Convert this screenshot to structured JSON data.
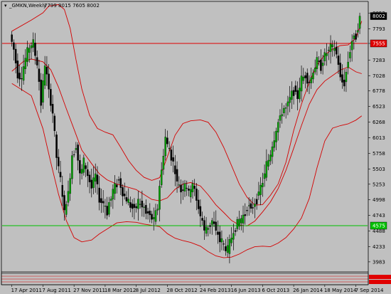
{
  "title": {
    "symbol": "_GMKN,Weekly",
    "ohlc": "7799 8015 7605 8002"
  },
  "colors": {
    "background": "#c0c0c0",
    "frame": "#000000",
    "bull_candle": "#00a000",
    "bear_candle": "#000000",
    "wick": "#000000",
    "bands": "#d40000",
    "red_level_line": "#e00000",
    "green_level_line": "#00c000",
    "last_price_box": "#000000",
    "red_level_box": "#e00000",
    "green_level_box": "#00c000"
  },
  "chart_data": {
    "type": "candlestick",
    "title": "_GMKN,Weekly",
    "ohlc_readout": [
      7799,
      8015,
      7605,
      8002
    ],
    "y_ticks": [
      8052,
      7793,
      7555,
      7283,
      7028,
      6778,
      6523,
      6268,
      6013,
      5758,
      5503,
      5253,
      4998,
      4743,
      4488,
      4233,
      3983
    ],
    "y_range": [
      3830,
      8230
    ],
    "x_labels": [
      "17 Apr 2011",
      "7 Aug 2011",
      "27 Nov 2011",
      "18 Mar 2012",
      "8 Jul 2012",
      "28 Oct 2012",
      "24 Feb 2013",
      "16 Jun 2013",
      "6 Oct 2013",
      "26 Jan 2014",
      "18 May 2014",
      "7 Sep 2014"
    ],
    "price_labels": {
      "last_price": "8002",
      "red_level": "7555",
      "green_level": "4575"
    },
    "horizontal_levels": [
      {
        "value": 7555,
        "color": "red"
      },
      {
        "value": 4575,
        "color": "green"
      }
    ],
    "bands": {
      "upper": [
        {
          "x": "17 Apr 2011",
          "y": 7755
        },
        {
          "x": "26 Jun 2011",
          "y": 7935
        },
        {
          "x": "7 Aug 2011",
          "y": 8055
        },
        {
          "x": "28 Aug 2011",
          "y": 8165
        },
        {
          "x": "2 Oct 2011",
          "y": 8190
        },
        {
          "x": "23 Oct 2011",
          "y": 8110
        },
        {
          "x": "13 Nov 2011",
          "y": 7800
        },
        {
          "x": "4 Dec 2011",
          "y": 7290
        },
        {
          "x": "25 Dec 2011",
          "y": 6810
        },
        {
          "x": "22 Jan 2012",
          "y": 6380
        },
        {
          "x": "19 Feb 2012",
          "y": 6165
        },
        {
          "x": "18 Mar 2012",
          "y": 6105
        },
        {
          "x": "15 Apr 2012",
          "y": 6060
        },
        {
          "x": "13 May 2012",
          "y": 5855
        },
        {
          "x": "10 Jun 2012",
          "y": 5640
        },
        {
          "x": "8 Jul 2012",
          "y": 5480
        },
        {
          "x": "5 Aug 2012",
          "y": 5365
        },
        {
          "x": "2 Sep 2012",
          "y": 5315
        },
        {
          "x": "30 Sep 2012",
          "y": 5360
        },
        {
          "x": "28 Oct 2012",
          "y": 5700
        },
        {
          "x": "25 Nov 2012",
          "y": 6055
        },
        {
          "x": "23 Dec 2012",
          "y": 6245
        },
        {
          "x": "20 Jan 2013",
          "y": 6290
        },
        {
          "x": "24 Feb 2013",
          "y": 6305
        },
        {
          "x": "24 Mar 2013",
          "y": 6265
        },
        {
          "x": "21 Apr 2013",
          "y": 6105
        },
        {
          "x": "19 May 2013",
          "y": 5855
        },
        {
          "x": "16 Jun 2013",
          "y": 5560
        },
        {
          "x": "14 Jul 2013",
          "y": 5255
        },
        {
          "x": "11 Aug 2013",
          "y": 5040
        },
        {
          "x": "8 Sep 2013",
          "y": 4910
        },
        {
          "x": "6 Oct 2013",
          "y": 4920
        },
        {
          "x": "3 Nov 2013",
          "y": 5070
        },
        {
          "x": "1 Dec 2013",
          "y": 5255
        },
        {
          "x": "29 Dec 2013",
          "y": 5610
        },
        {
          "x": "26 Jan 2014",
          "y": 6130
        },
        {
          "x": "23 Feb 2014",
          "y": 6560
        },
        {
          "x": "23 Mar 2014",
          "y": 6920
        },
        {
          "x": "20 Apr 2014",
          "y": 7200
        },
        {
          "x": "18 May 2014",
          "y": 7370
        },
        {
          "x": "15 Jun 2014",
          "y": 7460
        },
        {
          "x": "13 Jul 2014",
          "y": 7520
        },
        {
          "x": "10 Aug 2014",
          "y": 7530
        },
        {
          "x": "7 Sep 2014",
          "y": 7640
        },
        {
          "x": "28 Sep 2014",
          "y": 7920
        }
      ],
      "middle": [
        {
          "x": "17 Apr 2011",
          "y": 7100
        },
        {
          "x": "29 May 2011",
          "y": 7260
        },
        {
          "x": "26 Jun 2011",
          "y": 7300
        },
        {
          "x": "7 Aug 2011",
          "y": 7255
        },
        {
          "x": "4 Sep 2011",
          "y": 7125
        },
        {
          "x": "2 Oct 2011",
          "y": 6840
        },
        {
          "x": "30 Oct 2011",
          "y": 6490
        },
        {
          "x": "27 Nov 2011",
          "y": 6150
        },
        {
          "x": "25 Dec 2011",
          "y": 5810
        },
        {
          "x": "29 Jan 2012",
          "y": 5590
        },
        {
          "x": "26 Feb 2012",
          "y": 5425
        },
        {
          "x": "25 Mar 2012",
          "y": 5325
        },
        {
          "x": "29 Apr 2012",
          "y": 5255
        },
        {
          "x": "3 Jun 2012",
          "y": 5210
        },
        {
          "x": "8 Jul 2012",
          "y": 5165
        },
        {
          "x": "5 Aug 2012",
          "y": 5085
        },
        {
          "x": "2 Sep 2012",
          "y": 5005
        },
        {
          "x": "30 Sep 2012",
          "y": 4980
        },
        {
          "x": "28 Oct 2012",
          "y": 5030
        },
        {
          "x": "25 Nov 2012",
          "y": 5170
        },
        {
          "x": "23 Dec 2012",
          "y": 5255
        },
        {
          "x": "20 Jan 2013",
          "y": 5280
        },
        {
          "x": "24 Feb 2013",
          "y": 5225
        },
        {
          "x": "24 Mar 2013",
          "y": 5080
        },
        {
          "x": "21 Apr 2013",
          "y": 4915
        },
        {
          "x": "19 May 2013",
          "y": 4790
        },
        {
          "x": "16 Jun 2013",
          "y": 4660
        },
        {
          "x": "14 Jul 2013",
          "y": 4585
        },
        {
          "x": "11 Aug 2013",
          "y": 4570
        },
        {
          "x": "8 Sep 2013",
          "y": 4650
        },
        {
          "x": "6 Oct 2013",
          "y": 4800
        },
        {
          "x": "3 Nov 2013",
          "y": 4960
        },
        {
          "x": "1 Dec 2013",
          "y": 5180
        },
        {
          "x": "29 Dec 2013",
          "y": 5480
        },
        {
          "x": "26 Jan 2014",
          "y": 5840
        },
        {
          "x": "23 Feb 2014",
          "y": 6210
        },
        {
          "x": "23 Mar 2014",
          "y": 6560
        },
        {
          "x": "20 Apr 2014",
          "y": 6800
        },
        {
          "x": "18 May 2014",
          "y": 6940
        },
        {
          "x": "15 Jun 2014",
          "y": 7030
        },
        {
          "x": "13 Jul 2014",
          "y": 7120
        },
        {
          "x": "10 Aug 2014",
          "y": 7170
        },
        {
          "x": "7 Sep 2014",
          "y": 7090
        },
        {
          "x": "28 Sep 2014",
          "y": 7060
        }
      ],
      "lower": [
        {
          "x": "17 Apr 2011",
          "y": 6900
        },
        {
          "x": "26 Jun 2011",
          "y": 6700
        },
        {
          "x": "7 Aug 2011",
          "y": 6160
        },
        {
          "x": "4 Sep 2011",
          "y": 5610
        },
        {
          "x": "2 Oct 2011",
          "y": 5090
        },
        {
          "x": "30 Oct 2011",
          "y": 4660
        },
        {
          "x": "27 Nov 2011",
          "y": 4380
        },
        {
          "x": "25 Dec 2011",
          "y": 4310
        },
        {
          "x": "29 Jan 2012",
          "y": 4340
        },
        {
          "x": "26 Feb 2012",
          "y": 4440
        },
        {
          "x": "25 Mar 2012",
          "y": 4520
        },
        {
          "x": "29 Apr 2012",
          "y": 4620
        },
        {
          "x": "3 Jun 2012",
          "y": 4640
        },
        {
          "x": "8 Jul 2012",
          "y": 4630
        },
        {
          "x": "5 Aug 2012",
          "y": 4600
        },
        {
          "x": "2 Sep 2012",
          "y": 4580
        },
        {
          "x": "30 Sep 2012",
          "y": 4560
        },
        {
          "x": "28 Oct 2012",
          "y": 4445
        },
        {
          "x": "25 Nov 2012",
          "y": 4370
        },
        {
          "x": "23 Dec 2012",
          "y": 4330
        },
        {
          "x": "20 Jan 2013",
          "y": 4300
        },
        {
          "x": "24 Feb 2013",
          "y": 4240
        },
        {
          "x": "24 Mar 2013",
          "y": 4150
        },
        {
          "x": "21 Apr 2013",
          "y": 4080
        },
        {
          "x": "19 May 2013",
          "y": 4050
        },
        {
          "x": "16 Jun 2013",
          "y": 4060
        },
        {
          "x": "14 Jul 2013",
          "y": 4110
        },
        {
          "x": "11 Aug 2013",
          "y": 4180
        },
        {
          "x": "8 Sep 2013",
          "y": 4230
        },
        {
          "x": "6 Oct 2013",
          "y": 4240
        },
        {
          "x": "3 Nov 2013",
          "y": 4230
        },
        {
          "x": "1 Dec 2013",
          "y": 4290
        },
        {
          "x": "29 Dec 2013",
          "y": 4380
        },
        {
          "x": "26 Jan 2014",
          "y": 4520
        },
        {
          "x": "23 Feb 2014",
          "y": 4700
        },
        {
          "x": "23 Mar 2014",
          "y": 5020
        },
        {
          "x": "20 Apr 2014",
          "y": 5520
        },
        {
          "x": "18 May 2014",
          "y": 5960
        },
        {
          "x": "15 Jun 2014",
          "y": 6170
        },
        {
          "x": "13 Jul 2014",
          "y": 6210
        },
        {
          "x": "10 Aug 2014",
          "y": 6240
        },
        {
          "x": "7 Sep 2014",
          "y": 6300
        },
        {
          "x": "28 Sep 2014",
          "y": 6370
        }
      ]
    },
    "price_path": [
      {
        "x": "17 Apr 2011",
        "y": 7700
      },
      {
        "x": "1 May 2011",
        "y": 7450
      },
      {
        "x": "15 May 2011",
        "y": 7050
      },
      {
        "x": "29 May 2011",
        "y": 7000
      },
      {
        "x": "12 Jun 2011",
        "y": 7300
      },
      {
        "x": "26 Jun 2011",
        "y": 7500
      },
      {
        "x": "10 Jul 2011",
        "y": 7550
      },
      {
        "x": "24 Jul 2011",
        "y": 7200
      },
      {
        "x": "7 Aug 2011",
        "y": 6600
      },
      {
        "x": "21 Aug 2011",
        "y": 7200
      },
      {
        "x": "4 Sep 2011",
        "y": 6800
      },
      {
        "x": "18 Sep 2011",
        "y": 6400
      },
      {
        "x": "2 Oct 2011",
        "y": 5700
      },
      {
        "x": "16 Oct 2011",
        "y": 5300
      },
      {
        "x": "30 Oct 2011",
        "y": 4800
      },
      {
        "x": "13 Nov 2011",
        "y": 5100
      },
      {
        "x": "27 Nov 2011",
        "y": 5700
      },
      {
        "x": "11 Dec 2011",
        "y": 5900
      },
      {
        "x": "25 Dec 2011",
        "y": 5400
      },
      {
        "x": "8 Jan 2012",
        "y": 5600
      },
      {
        "x": "22 Jan 2012",
        "y": 5400
      },
      {
        "x": "5 Feb 2012",
        "y": 5200
      },
      {
        "x": "19 Feb 2012",
        "y": 5400
      },
      {
        "x": "4 Mar 2012",
        "y": 5000
      },
      {
        "x": "18 Mar 2012",
        "y": 4950
      },
      {
        "x": "1 Apr 2012",
        "y": 4800
      },
      {
        "x": "15 Apr 2012",
        "y": 5050
      },
      {
        "x": "29 Apr 2012",
        "y": 5200
      },
      {
        "x": "13 May 2012",
        "y": 5350
      },
      {
        "x": "27 May 2012",
        "y": 5100
      },
      {
        "x": "10 Jun 2012",
        "y": 5000
      },
      {
        "x": "24 Jun 2012",
        "y": 4900
      },
      {
        "x": "8 Jul 2012",
        "y": 4850
      },
      {
        "x": "22 Jul 2012",
        "y": 4950
      },
      {
        "x": "5 Aug 2012",
        "y": 4900
      },
      {
        "x": "19 Aug 2012",
        "y": 4800
      },
      {
        "x": "2 Sep 2012",
        "y": 4750
      },
      {
        "x": "16 Sep 2012",
        "y": 4650
      },
      {
        "x": "30 Sep 2012",
        "y": 4900
      },
      {
        "x": "14 Oct 2012",
        "y": 5500
      },
      {
        "x": "28 Oct 2012",
        "y": 6000
      },
      {
        "x": "11 Nov 2012",
        "y": 5800
      },
      {
        "x": "25 Nov 2012",
        "y": 5600
      },
      {
        "x": "9 Dec 2012",
        "y": 5300
      },
      {
        "x": "23 Dec 2012",
        "y": 5150
      },
      {
        "x": "6 Jan 2013",
        "y": 5250
      },
      {
        "x": "20 Jan 2013",
        "y": 5100
      },
      {
        "x": "3 Feb 2013",
        "y": 5250
      },
      {
        "x": "17 Feb 2013",
        "y": 5000
      },
      {
        "x": "3 Mar 2013",
        "y": 4750
      },
      {
        "x": "17 Mar 2013",
        "y": 4500
      },
      {
        "x": "31 Mar 2013",
        "y": 4550
      },
      {
        "x": "14 Apr 2013",
        "y": 4650
      },
      {
        "x": "28 Apr 2013",
        "y": 4500
      },
      {
        "x": "12 May 2013",
        "y": 4350
      },
      {
        "x": "26 May 2013",
        "y": 4250
      },
      {
        "x": "9 Jun 2013",
        "y": 4150
      },
      {
        "x": "23 Jun 2013",
        "y": 4400
      },
      {
        "x": "7 Jul 2013",
        "y": 4550
      },
      {
        "x": "21 Jul 2013",
        "y": 4650
      },
      {
        "x": "4 Aug 2013",
        "y": 4700
      },
      {
        "x": "18 Aug 2013",
        "y": 4900
      },
      {
        "x": "1 Sep 2013",
        "y": 4850
      },
      {
        "x": "15 Sep 2013",
        "y": 4950
      },
      {
        "x": "29 Sep 2013",
        "y": 5100
      },
      {
        "x": "13 Oct 2013",
        "y": 5300
      },
      {
        "x": "27 Oct 2013",
        "y": 5550
      },
      {
        "x": "10 Nov 2013",
        "y": 5750
      },
      {
        "x": "24 Nov 2013",
        "y": 6000
      },
      {
        "x": "8 Dec 2013",
        "y": 6250
      },
      {
        "x": "22 Dec 2013",
        "y": 6450
      },
      {
        "x": "5 Jan 2014",
        "y": 6500
      },
      {
        "x": "19 Jan 2014",
        "y": 6650
      },
      {
        "x": "2 Feb 2014",
        "y": 6800
      },
      {
        "x": "16 Feb 2014",
        "y": 6700
      },
      {
        "x": "2 Mar 2014",
        "y": 6950
      },
      {
        "x": "16 Mar 2014",
        "y": 7050
      },
      {
        "x": "30 Mar 2014",
        "y": 6900
      },
      {
        "x": "13 Apr 2014",
        "y": 7100
      },
      {
        "x": "27 Apr 2014",
        "y": 7250
      },
      {
        "x": "11 May 2014",
        "y": 7200
      },
      {
        "x": "25 May 2014",
        "y": 7350
      },
      {
        "x": "8 Jun 2014",
        "y": 7450
      },
      {
        "x": "22 Jun 2014",
        "y": 7500
      },
      {
        "x": "6 Jul 2014",
        "y": 7400
      },
      {
        "x": "20 Jul 2014",
        "y": 7000
      },
      {
        "x": "3 Aug 2014",
        "y": 6900
      },
      {
        "x": "17 Aug 2014",
        "y": 7300
      },
      {
        "x": "31 Aug 2014",
        "y": 7600
      },
      {
        "x": "14 Sep 2014",
        "y": 7700
      },
      {
        "x": "28 Sep 2014",
        "y": 8002
      }
    ],
    "grid": false
  }
}
